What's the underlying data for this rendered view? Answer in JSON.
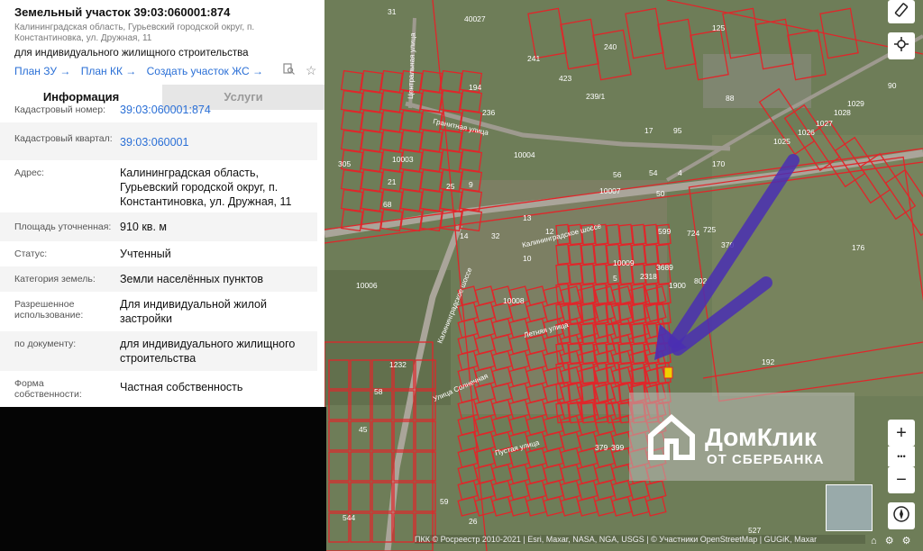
{
  "panel": {
    "title": "Земельный участок 39:03:060001:874",
    "address_line": "Калининградская область, Гурьевский городской округ, п. Константиновка, ул. Дружная, 11",
    "purpose": "для индивидуального жилищного строительства",
    "links": [
      "План ЗУ →",
      "План КК →",
      "Создать участок ЖС →"
    ],
    "tabs": {
      "info": "Информация",
      "services": "Услуги"
    },
    "rows": [
      {
        "label": "Кадастровый номер:",
        "value": "39:03:060001:874",
        "link": true
      },
      {
        "label": "Кадастровый квартал:",
        "value": "39:03:060001",
        "link": true
      },
      {
        "label": "Адрес:",
        "value": "Калининградская область, Гурьевский городской округ, п. Константиновка, ул. Дружная, 11"
      },
      {
        "label": "Площадь уточненная:",
        "value": "910 кв. м"
      },
      {
        "label": "Статус:",
        "value": "Учтенный"
      },
      {
        "label": "Категория земель:",
        "value": "Земли населённых пунктов"
      },
      {
        "label": "Разрешенное использование:",
        "value": "Для индивидуальной жилой застройки"
      },
      {
        "label": "по документу:",
        "value": "для индивидуального жилищного строительства"
      },
      {
        "label": "Форма собственности:",
        "value": "Частная собственность"
      }
    ]
  },
  "map": {
    "watermark_line1": "ДомКлик",
    "watermark_line2": "ОТ СБЕРБАНКА",
    "attribution": "ПКК © Росреестр 2010-2021 | Esri, Maxar, NASA, NGA, USGS | © Участники OpenStreetMap | GUGiK, Maxar",
    "streets": [
      "Калининградское шоссе",
      "Калининградское шоссе",
      "Гранитная улица",
      "Центральная улица",
      "Летняя улица",
      "Улица Солнечная",
      "Пустая улица"
    ],
    "parcel_labels": [
      "31",
      "40027",
      "125",
      "240",
      "241",
      "194",
      "423",
      "239/1",
      "88",
      "90",
      "236",
      "95",
      "17",
      "1029",
      "1028",
      "1027",
      "1026",
      "1025",
      "10003",
      "10004",
      "170",
      "10007",
      "56",
      "54",
      "4",
      "50",
      "13",
      "12",
      "599",
      "724",
      "725",
      "370",
      "176",
      "10009",
      "2318",
      "3689",
      "1900",
      "802",
      "10006",
      "10008",
      "192",
      "379",
      "399",
      "527",
      "1232",
      "58",
      "45",
      "59",
      "26",
      "544",
      "305",
      "21",
      "68",
      "9",
      "25",
      "32",
      "14",
      "10",
      "5"
    ],
    "accent": "#5a2fb5",
    "parcel_color": "#e0262a",
    "zoom_in": "+",
    "zoom_out": "−",
    "more": "•••"
  },
  "icons": [
    "ruler-icon",
    "locate-icon",
    "plus-icon",
    "more-icon",
    "minus-icon",
    "compass-icon",
    "search-doc-icon",
    "star-icon",
    "home-icon",
    "gear-icon"
  ]
}
